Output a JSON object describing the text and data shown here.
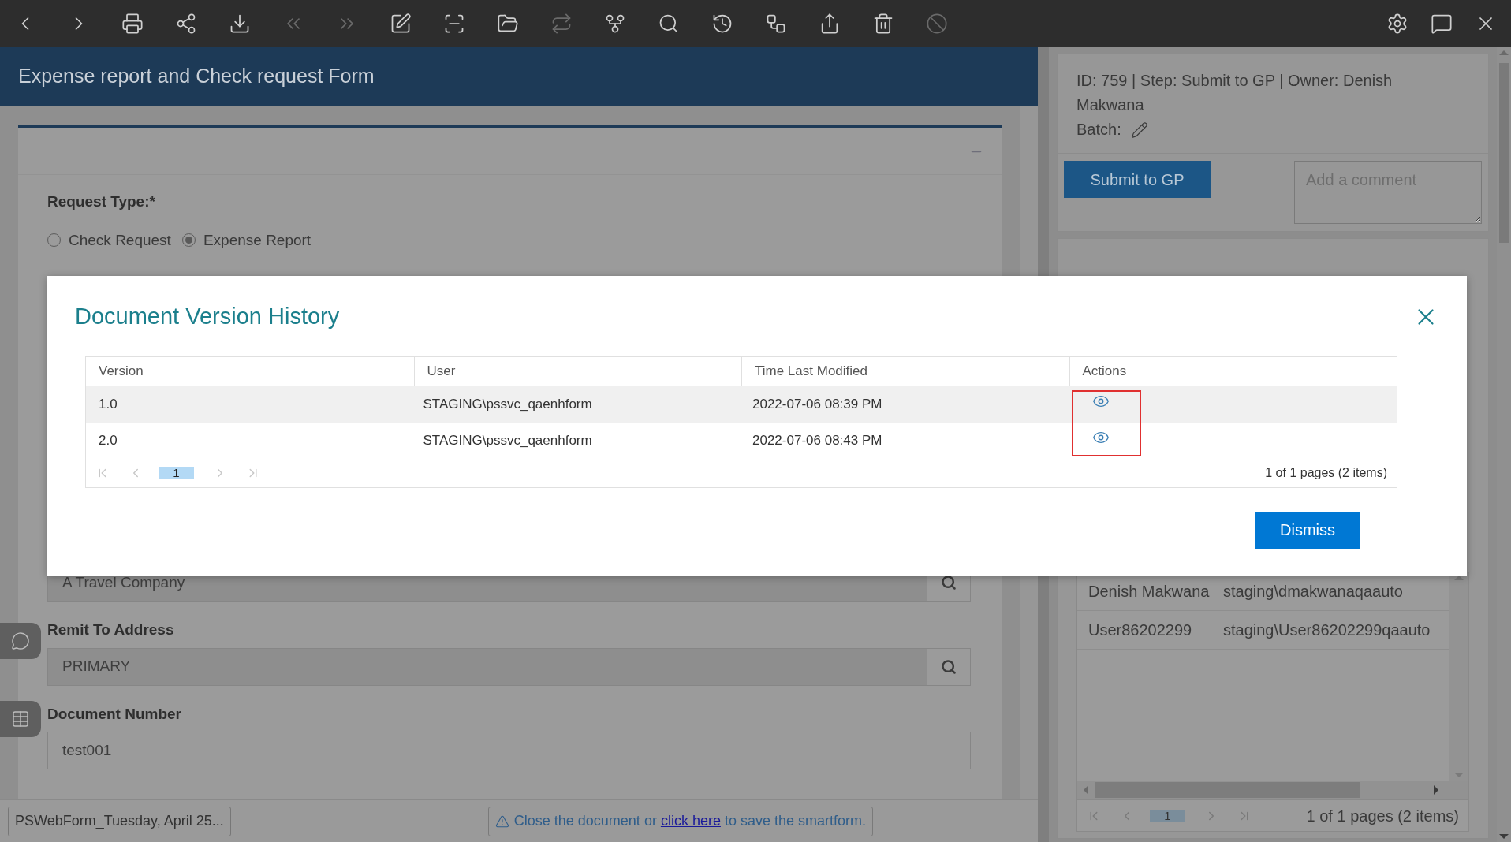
{
  "toolbar": {
    "left": [
      {
        "kind": "back",
        "disabled": false
      },
      {
        "kind": "forward",
        "disabled": false
      },
      {
        "kind": "print",
        "disabled": false
      },
      {
        "kind": "share",
        "disabled": false
      },
      {
        "kind": "download",
        "disabled": false
      },
      {
        "kind": "first",
        "disabled": true
      },
      {
        "kind": "last",
        "disabled": true
      },
      {
        "kind": "edit",
        "disabled": false
      },
      {
        "kind": "scan",
        "disabled": false
      },
      {
        "kind": "folder",
        "disabled": false
      },
      {
        "kind": "swap",
        "disabled": true
      },
      {
        "kind": "branch",
        "disabled": false
      },
      {
        "kind": "search",
        "disabled": false
      },
      {
        "kind": "history",
        "disabled": false
      },
      {
        "kind": "workflow",
        "disabled": false
      },
      {
        "kind": "export",
        "disabled": false
      },
      {
        "kind": "delete",
        "disabled": false
      },
      {
        "kind": "block",
        "disabled": true
      }
    ],
    "right": [
      {
        "kind": "settings"
      },
      {
        "kind": "feedback"
      },
      {
        "kind": "close"
      }
    ]
  },
  "form": {
    "title": "Expense report and Check request Form",
    "request_type": {
      "label": "Request Type:*",
      "options": [
        {
          "label": "Check Request",
          "selected": false
        },
        {
          "label": "Expense Report",
          "selected": true
        }
      ]
    },
    "fields": [
      {
        "kind": "lookup",
        "value": "A Travel Company"
      },
      {
        "kind": "lookup",
        "label": "Remit To Address",
        "value": "PRIMARY"
      },
      {
        "kind": "text",
        "label": "Document Number",
        "value": "test001"
      }
    ]
  },
  "side_tabs": [
    {
      "kind": "comments"
    },
    {
      "kind": "table"
    }
  ],
  "footer": {
    "document_tab": "PSWebForm_Tuesday, April 25...",
    "notice_before": "Close the document or ",
    "notice_link": "click here",
    "notice_after": " to save the smartform."
  },
  "right_panel": {
    "info": "ID: 759 | Step: Submit to GP | Owner: Denish Makwana",
    "batch_label": "Batch:",
    "submit_button": "Submit to GP",
    "comment_placeholder": "Add a comment",
    "users": {
      "rows": [
        [
          "Denish Makwana",
          "staging\\dmakwanaqaauto"
        ],
        [
          "User86202299",
          "staging\\User86202299qaauto"
        ]
      ],
      "pages": [
        {
          "label": "1",
          "selected": true
        }
      ],
      "summary": "1 of 1 pages (2 items)"
    }
  },
  "modal": {
    "title": "Document Version History",
    "columns": [
      "Version",
      "User",
      "Time Last Modified",
      "Actions"
    ],
    "rows": [
      {
        "version": "1.0",
        "user": "STAGING\\pssvc_qaenhform",
        "time": "2022-07-06 08:39 PM"
      },
      {
        "version": "2.0",
        "user": "STAGING\\pssvc_qaenhform",
        "time": "2022-07-06 08:43 PM"
      }
    ],
    "actions_highlighted": true,
    "pages": [
      {
        "label": "1",
        "selected": true
      }
    ],
    "summary": "1 of 1 pages (2 items)",
    "dismiss": "Dismiss"
  }
}
